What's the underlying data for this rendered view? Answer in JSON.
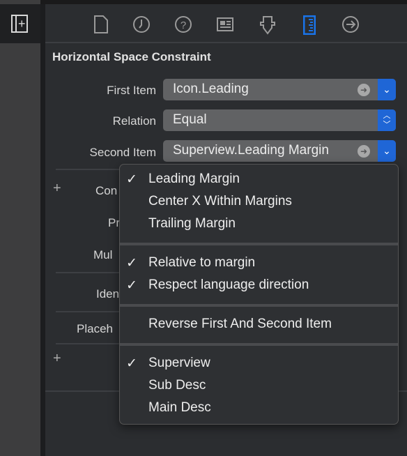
{
  "sidebar": {
    "toggle_icon": "sidebar-add-icon"
  },
  "toolbar": {
    "icons": [
      "file-inspector-icon",
      "history-icon",
      "help-icon",
      "identity-icon",
      "attributes-icon",
      "size-inspector-icon",
      "connections-icon"
    ],
    "active": "size-inspector-icon",
    "accent": "#1a73e8"
  },
  "section": {
    "title": "Horizontal Space Constraint"
  },
  "fields": {
    "first_item": {
      "label": "First Item",
      "value": "Icon.Leading"
    },
    "relation": {
      "label": "Relation",
      "value": "Equal"
    },
    "second_item": {
      "label": "Second Item",
      "value": "Superview.Leading Margin"
    }
  },
  "partial_labels": [
    "Con",
    "Pr",
    "Mul",
    "Iden",
    "Placeh"
  ],
  "menu": {
    "groups": [
      [
        {
          "label": "Leading Margin",
          "checked": true
        },
        {
          "label": "Center X Within Margins",
          "checked": false
        },
        {
          "label": "Trailing Margin",
          "checked": false
        }
      ],
      [
        {
          "label": "Relative to margin",
          "checked": true
        },
        {
          "label": "Respect language direction",
          "checked": true
        }
      ],
      [
        {
          "label": "Reverse First And Second Item",
          "checked": false
        }
      ],
      [
        {
          "label": "Superview",
          "checked": true
        },
        {
          "label": "Sub Desc",
          "checked": false
        },
        {
          "label": "Main Desc",
          "checked": false
        }
      ]
    ],
    "check": "✓"
  }
}
